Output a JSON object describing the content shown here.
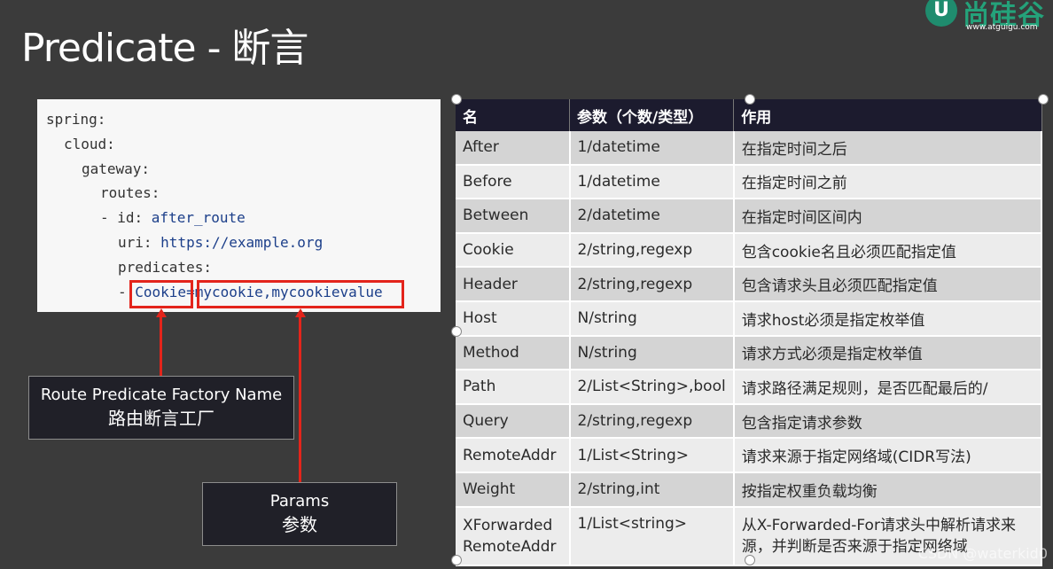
{
  "slide": {
    "title": "Predicate - 断言"
  },
  "logo": {
    "name": "尚硅谷",
    "url": "www.atguigu.com",
    "mark": "U"
  },
  "code": {
    "lines": [
      {
        "key": "spring:",
        "val": ""
      },
      {
        "key": "cloud:",
        "val": ""
      },
      {
        "key": "gateway:",
        "val": ""
      },
      {
        "key": "routes:",
        "val": ""
      },
      {
        "key": "- id: ",
        "val": "after_route"
      },
      {
        "key": "uri: ",
        "val": "https://example.org"
      },
      {
        "key": "predicates:",
        "val": ""
      },
      {
        "key": "- ",
        "val": "Cookie=mycookie,mycookievalue"
      }
    ]
  },
  "labels": {
    "factory_en": "Route Predicate Factory Name",
    "factory_zh": "路由断言工厂",
    "params_en": "Params",
    "params_zh": "参数"
  },
  "table": {
    "headers": [
      "名",
      "参数（个数/类型）",
      "作用"
    ],
    "rows": [
      [
        "After",
        "1/datetime",
        "在指定时间之后"
      ],
      [
        "Before",
        "1/datetime",
        "在指定时间之前"
      ],
      [
        "Between",
        "2/datetime",
        "在指定时间区间内"
      ],
      [
        "Cookie",
        "2/string,regexp",
        "包含cookie名且必须匹配指定值"
      ],
      [
        "Header",
        "2/string,regexp",
        "包含请求头且必须匹配指定值"
      ],
      [
        "Host",
        "N/string",
        "请求host必须是指定枚举值"
      ],
      [
        "Method",
        "N/string",
        "请求方式必须是指定枚举值"
      ],
      [
        "Path",
        "2/List<String>,bool",
        "请求路径满足规则，是否匹配最后的/"
      ],
      [
        "Query",
        "2/string,regexp",
        "包含指定请求参数"
      ],
      [
        "RemoteAddr",
        "1/List<String>",
        "请求来源于指定网络域(CIDR写法)"
      ],
      [
        "Weight",
        "2/string,int",
        "按指定权重负载均衡"
      ],
      [
        "XForwarded RemoteAddr",
        "1/List<string>",
        "从X-Forwarded-For请求头中解析请求来源，并判断是否来源于指定网络域"
      ]
    ]
  },
  "watermark": "CSDN @waterkid0",
  "colors": {
    "background": "#3b3b3b",
    "highlight": "#e3241b",
    "header": "#1c1b2e",
    "brand": "#24a27a"
  }
}
